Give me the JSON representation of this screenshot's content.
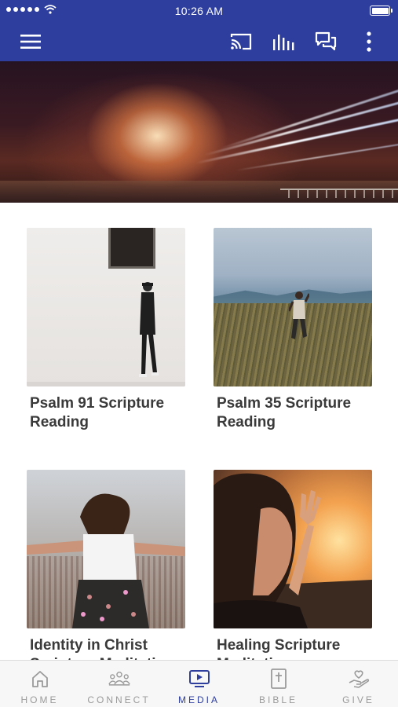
{
  "status_bar": {
    "time": "10:26 AM",
    "signal_icon": "signal-dots-icon",
    "wifi_icon": "wifi-icon",
    "battery_icon": "battery-icon"
  },
  "app_bar": {
    "background_color": "#2e3e9e",
    "icons": [
      "menu-icon",
      "cast-icon",
      "audio-bars-icon",
      "chat-icon",
      "more-vertical-icon"
    ]
  },
  "hero": {
    "image": "highway-light-trails-sunset"
  },
  "media_items": [
    {
      "title": "Psalm 91 Scripture Reading",
      "image": "man-walking-by-white-wall"
    },
    {
      "title": "Psalm 35 Scripture Reading",
      "image": "man-running-in-field"
    },
    {
      "title": "Identity in Christ Scripture Meditation",
      "image": "woman-arms-outstretched-over-city"
    },
    {
      "title": "Healing Scripture Meditation",
      "image": "woman-hand-raised-at-sunset"
    }
  ],
  "tabs": [
    {
      "label": "HOME",
      "icon": "home-icon",
      "active": false
    },
    {
      "label": "CONNECT",
      "icon": "people-icon",
      "active": false
    },
    {
      "label": "MEDIA",
      "icon": "media-tv-icon",
      "active": true
    },
    {
      "label": "BIBLE",
      "icon": "bible-icon",
      "active": false
    },
    {
      "label": "GIVE",
      "icon": "give-hand-heart-icon",
      "active": false
    }
  ],
  "colors": {
    "accent": "#2e3e9e",
    "inactive_tab": "#9a9a9a",
    "card_title": "#3a3a3a"
  }
}
